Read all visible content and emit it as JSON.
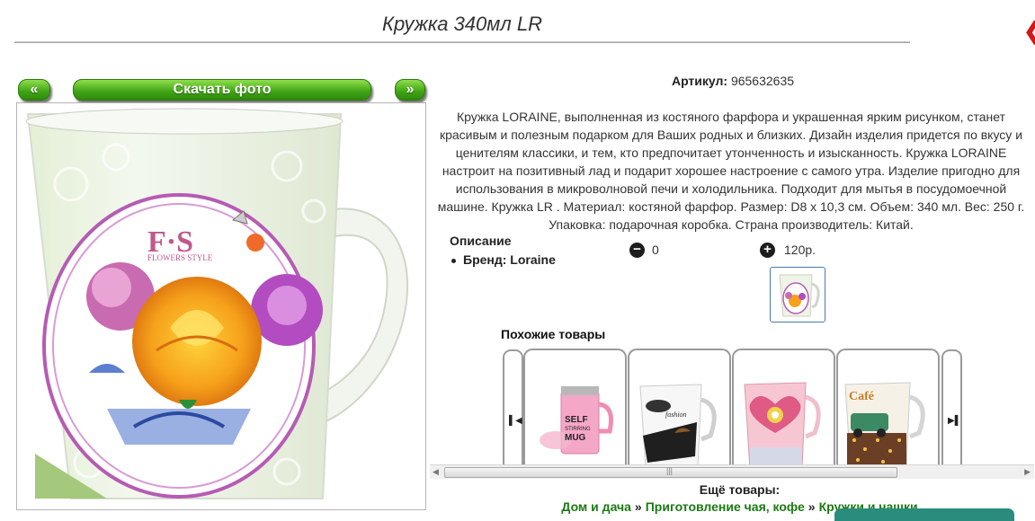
{
  "header": {
    "title": "Кружка 340мл LR"
  },
  "photo_nav": {
    "prev_label": "«",
    "download_label": "Скачать фото",
    "next_label": "»"
  },
  "product": {
    "sku_label": "Артикул:",
    "sku_value": "965632635",
    "description": "Кружка LORAINE, выполненная из костяного фарфора и украшенная ярким рисунком, станет красивым и полезным подарком для Ваших родных и близких. Дизайн изделия придется по вкусу и ценителям классики, и тем, кто предпочитает утонченность и изысканность. Кружка LORAINE настроит на позитивный лад и подарит хорошее настроение с самого утра. Изделие пригодно для использования в микроволновой печи и холодильника. Подходит для мытья в посудомоечной машине. Кружка LR . Материал: костяной фарфор. Размер: D8 x 10,3 см. Объем: 340 мл. Вес: 250 г. Упаковка: подарочная коробка. Страна производитель: Китай.",
    "section_title": "Описание",
    "brand_label": "Бренд: Loraine",
    "quantity": "0",
    "price": "120р.",
    "mug_print": {
      "brand": "F·S",
      "subtitle": "FLOWERS STYLE"
    }
  },
  "similar": {
    "title": "Похожие товары",
    "items": [
      {
        "name": "self-stirring-mug",
        "print": "SELF STIRRING MUG"
      },
      {
        "name": "mug-fashion",
        "print": "fashion"
      },
      {
        "name": "mug-heart",
        "print": ""
      },
      {
        "name": "mug-cafe",
        "print": "Café"
      }
    ]
  },
  "more": {
    "title": "Ещё товары:",
    "breadcrumbs": [
      "Дом и дача",
      "Приготовление чая, кофе",
      "Кружки и чашки"
    ],
    "separator": "»"
  },
  "colors": {
    "accent_green": "#3fa316",
    "link_green": "#1a7a12",
    "close_red": "#d01818"
  }
}
